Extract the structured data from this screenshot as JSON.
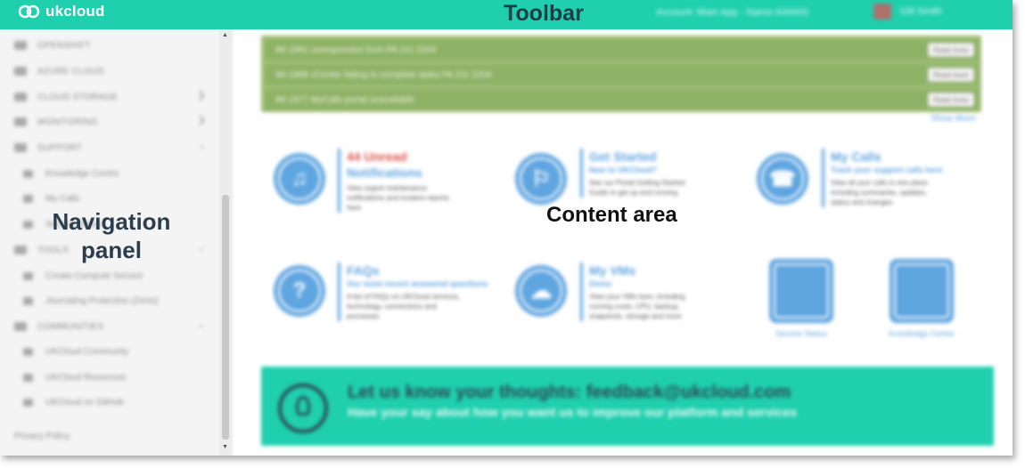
{
  "toolbar": {
    "logo_text": "ukcloud",
    "label": "Toolbar",
    "user_text": "Account: Main App - Name A00000",
    "account_text": "Gill Smith"
  },
  "sidebar": {
    "overlay_label": "Navigation panel",
    "items": [
      {
        "label": "OPENSHIFT",
        "icon": "openshift-icon"
      },
      {
        "label": "AZURE CLOUD",
        "icon": "azure-icon"
      },
      {
        "label": "CLOUD STORAGE",
        "icon": "storage-icon"
      },
      {
        "label": "MONITORING",
        "icon": "monitoring-icon"
      },
      {
        "label": "SUPPORT",
        "icon": "support-icon"
      },
      {
        "label": "Knowledge Centre",
        "icon": "book-icon"
      },
      {
        "label": "My Calls",
        "icon": "phone-icon"
      },
      {
        "label": "Service Status",
        "icon": "chart-icon"
      },
      {
        "label": "TOOLS",
        "icon": "tools-icon"
      },
      {
        "label": "Create Compute Service",
        "icon": "compute-icon"
      },
      {
        "label": "Journaling Protection (Zerto)",
        "icon": "journal-icon"
      },
      {
        "label": "COMMUNITIES",
        "icon": "community-icon"
      },
      {
        "label": "UKCloud Community",
        "icon": "link-icon"
      },
      {
        "label": "UKCloud Resources",
        "icon": "link-icon"
      },
      {
        "label": "UKCloud on GitHub",
        "icon": "link-icon"
      }
    ],
    "privacy": "Privacy Policy"
  },
  "content": {
    "label": "Content area",
    "alerts": [
      {
        "text": "IM-1991 unresponsive from PA 211 2204",
        "button": "Read more"
      },
      {
        "text": "IM-1998 vCenter failing to complete tasks PA 211 2204",
        "button": "Read more"
      },
      {
        "text": "IM-1977 MyCalls portal unavailable",
        "button": "Read more"
      }
    ],
    "show_more": "Show More",
    "tiles": [
      {
        "title": "44 Unread",
        "subtitle": "Notifications",
        "desc": "View urgent maintenance notifications and incident reports here"
      },
      {
        "title": "Get Started",
        "subtitle": "New to UKCloud?",
        "desc": "See our Portal Getting Started Guide to get up and running"
      },
      {
        "title": "My Calls",
        "subtitle": "Track your support calls here",
        "desc": "View all your calls in one place including summaries, updates, status and changes"
      },
      {
        "title": "FAQs",
        "subtitle": "Our most recent answered questions",
        "desc": "A list of FAQs on UKCloud services, technology, connections and processes"
      },
      {
        "title": "My VMs",
        "subtitle": "Demo",
        "desc": "View your VMs here, including running costs, CPU, backup, snapshots, storage and more"
      }
    ],
    "square_tiles": [
      {
        "label": "Service Status"
      },
      {
        "label": "Knowledge Centre"
      }
    ],
    "feedback": {
      "title": "Let us know your thoughts: feedback@ukcloud.com",
      "subtitle": "Have your say about how you want us to improve our platform and services"
    }
  },
  "colors": {
    "brand": "#1fcfae",
    "accent": "#5fa5e0",
    "alert": "#8eb266",
    "unread": "#d9534f"
  }
}
